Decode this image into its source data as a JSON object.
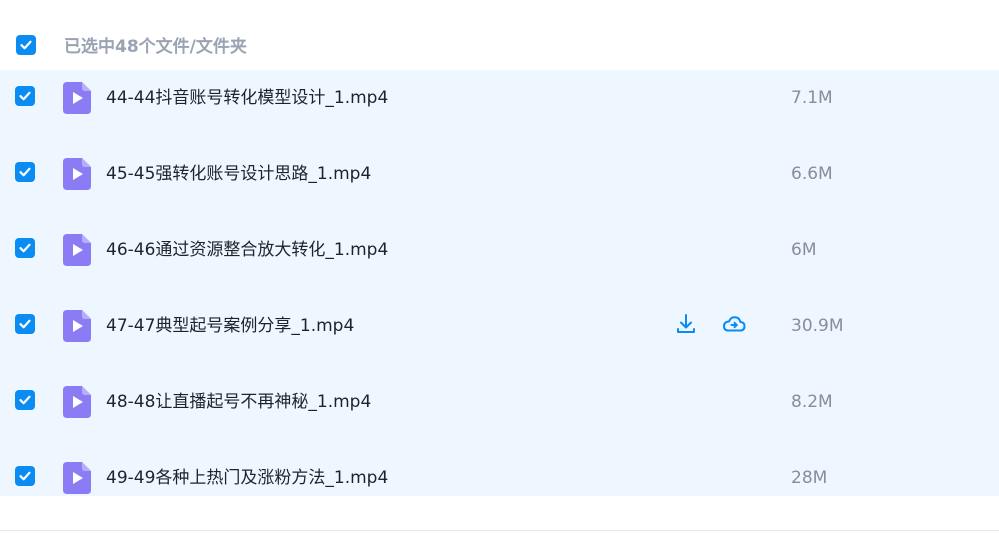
{
  "selection": {
    "summary": "已选中48个文件/文件夹",
    "all_checked": true
  },
  "files": [
    {
      "name": "44-44抖音账号转化模型设计_1.mp4",
      "size": "7.1M",
      "checked": true
    },
    {
      "name": "45-45强转化账号设计思路_1.mp4",
      "size": "6.6M",
      "checked": true
    },
    {
      "name": "46-46通过资源整合放大转化_1.mp4",
      "size": "6M",
      "checked": true
    },
    {
      "name": "47-47典型起号案例分享_1.mp4",
      "size": "30.9M",
      "checked": true,
      "hover_actions": [
        "download-icon",
        "cloud-save-icon"
      ]
    },
    {
      "name": "48-48让直播起号不再神秘_1.mp4",
      "size": "8.2M",
      "checked": true
    },
    {
      "name": "49-49各种上热门及涨粉方法_1.mp4",
      "size": "28M",
      "checked": true
    }
  ],
  "colors": {
    "accent": "#0b8cf3",
    "selected_row_bg": "#eef7ff",
    "file_icon": "#8b7cf6"
  }
}
